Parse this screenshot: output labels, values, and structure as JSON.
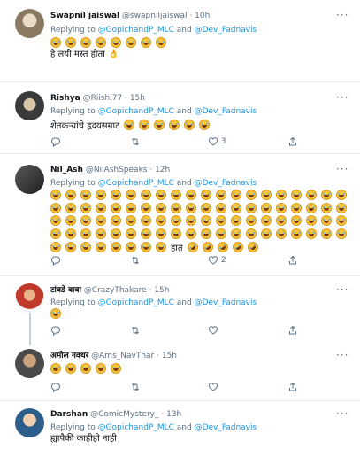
{
  "reply_prefix": "Replying to",
  "and_word": "and",
  "tweets": [
    {
      "name": "Swapnil jaiswal",
      "handle": "@swapniljaiswal",
      "time": "· 10h",
      "mentions": [
        "@GopichandP_MLC",
        "@Dev_Fadnavis"
      ],
      "emoji_lines": [
        {
          "count": 8,
          "name": "laughing-tears-emoji"
        }
      ],
      "text": "हे लयी मस्त होता 👌"
    },
    {
      "name": "Rishya",
      "handle": "@Riishi77",
      "time": "· 15h",
      "mentions": [
        "@GopichandP_MLC",
        "@Dev_Fadnavis"
      ],
      "text": "शेतकऱ्यांचे हृदयसम्राट",
      "trailing_emoji_count": 6,
      "likes": "3"
    },
    {
      "name": "Nil_Ash",
      "handle": "@NilAshSpeaks",
      "time": "· 12h",
      "mentions": [
        "@GopichandP_MLC",
        "@Dev_Fadnavis"
      ],
      "emoji_rows": 4,
      "emoji_per_row": 20,
      "last_row_emoji": 8,
      "last_row_word": "हात",
      "rofl_count": 5,
      "likes": "2"
    },
    {
      "name": "टांबडे बाबा",
      "handle": "@CrazyThakare",
      "time": "· 15h",
      "mentions": [
        "@GopichandP_MLC",
        "@Dev_Fadnavis"
      ],
      "emoji_count": 1
    },
    {
      "name": "अमोल नवथर",
      "handle": "@Ams_NavThar",
      "time": "· 15h",
      "emoji_count": 5
    },
    {
      "name": "Darshan",
      "handle": "@ComicMystery_",
      "time": "· 13h",
      "mentions": [
        "@GopichandP_MLC",
        "@Dev_Fadnavis"
      ],
      "text": "ह्यापैकी काहीही नाही"
    }
  ],
  "colors": {
    "link": "#1b95e0",
    "muted": "#5b7083",
    "separator": "#e6ecf0"
  }
}
